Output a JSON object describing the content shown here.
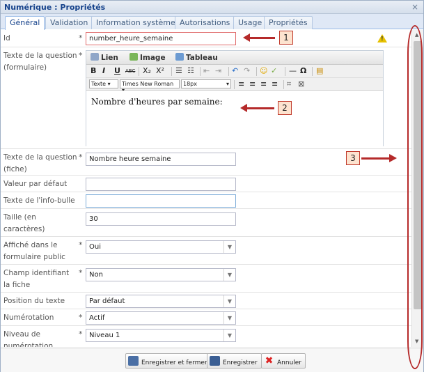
{
  "window": {
    "title": "Numérique : Propriétés",
    "close_glyph": "×"
  },
  "tabs": [
    {
      "label": "Général"
    },
    {
      "label": "Validation"
    },
    {
      "label": "Information système"
    },
    {
      "label": "Autorisations"
    },
    {
      "label": "Usage"
    },
    {
      "label": "Propriétés"
    }
  ],
  "fields": {
    "id": {
      "label": "Id",
      "required": "*",
      "value": "number_heure_semaine"
    },
    "question_form": {
      "label": "Texte de la question (formulaire)",
      "required": "*"
    },
    "question_fiche": {
      "label": "Texte de la question (fiche)",
      "required": "*",
      "value": "Nombre heure semaine"
    },
    "default_value": {
      "label": "Valeur par défaut",
      "value": ""
    },
    "tooltip": {
      "label": "Texte de l'info-bulle",
      "value": ""
    },
    "size": {
      "label": "Taille (en caractères)",
      "value": "30"
    },
    "public": {
      "label": "Affiché dans le formulaire public",
      "required": "*",
      "value": "Oui"
    },
    "identifier": {
      "label": "Champ identifiant la fiche",
      "required": "*",
      "value": "Non"
    },
    "text_position": {
      "label": "Position du texte",
      "value": "Par défaut"
    },
    "numbering": {
      "label": "Numérotation",
      "required": "*",
      "value": "Actif"
    },
    "numbering_level": {
      "label": "Niveau de numérotation",
      "required": "*",
      "value": "Niveau 1"
    }
  },
  "editor": {
    "tabs": [
      "Lien",
      "Image",
      "Tableau"
    ],
    "bold": "B",
    "italic": "I",
    "underline": "U",
    "strike": "ABC",
    "sub": "X₂",
    "sup": "X²",
    "format_select": "Texte",
    "font_select": "Times New Roman",
    "size_select": "18px",
    "omega": "Ω",
    "content": "Nombre d'heures par semaine:"
  },
  "warning_glyph": "!",
  "buttons": {
    "save_close": "Enregistrer et fermer",
    "save": "Enregistrer",
    "cancel": "Annuler"
  },
  "callouts": [
    "1",
    "2",
    "3"
  ],
  "colors": {
    "accent": "#15428b",
    "annotation": "#b52a2a",
    "warning": "#e6c100"
  }
}
